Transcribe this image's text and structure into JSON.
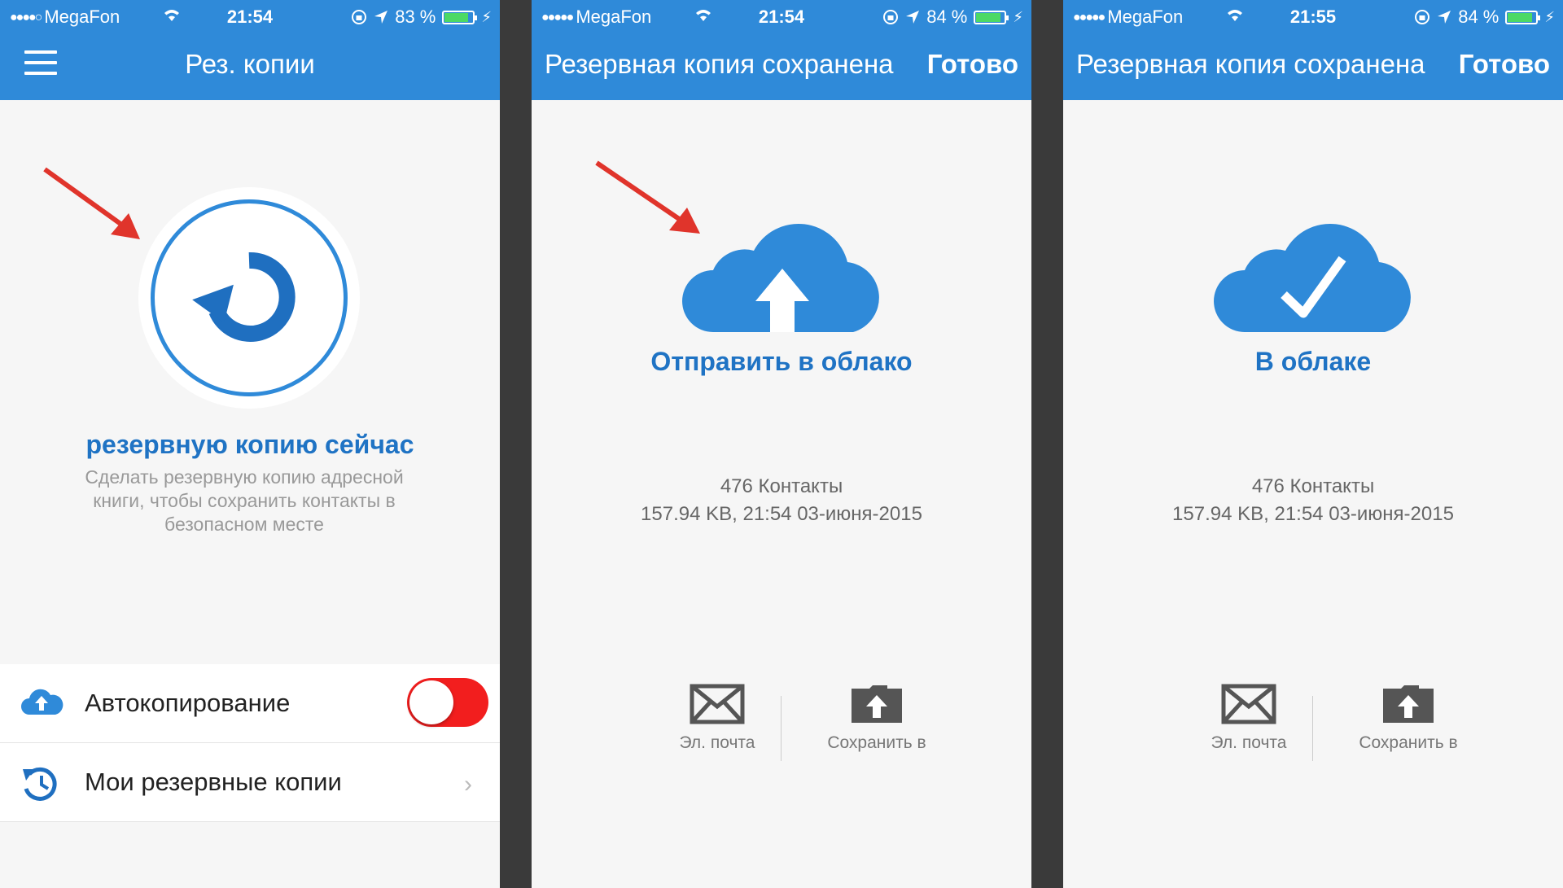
{
  "colors": {
    "accent": "#2f8ad9",
    "title_blue": "#1f73c4",
    "toggle_red": "#f21e1e",
    "arrow_red": "#e0342b"
  },
  "screens": [
    {
      "status": {
        "carrier": "MegaFon",
        "time": "21:54",
        "battery": "83 %"
      },
      "nav": {
        "title": "Рез. копии",
        "menu_icon": "hamburger-icon"
      },
      "backup": {
        "icon": "refresh-icon",
        "title": "резервную копию сейчас",
        "desc_line1": "Сделать резервную копию адресной",
        "desc_line2": "книги, чтобы сохранить контакты в",
        "desc_line3": "безопасном месте"
      },
      "list": [
        {
          "label": "Автокопирование",
          "icon": "cloud-upload-icon",
          "toggle_on": true
        },
        {
          "label": "Мои резервные копии",
          "icon": "history-icon"
        }
      ]
    },
    {
      "status": {
        "carrier": "MegaFon",
        "time": "21:54",
        "battery": "84 %"
      },
      "nav": {
        "title": "Резервная копия сохранена",
        "done": "Готово"
      },
      "cloud": {
        "icon": "cloud-upload-icon",
        "label": "Отправить в облако"
      },
      "info": {
        "contacts": "476 Контакты",
        "details": "157.94 KB, 21:54 03-июня-2015"
      },
      "actions": {
        "email": "Эл. почта",
        "save": "Сохранить в"
      }
    },
    {
      "status": {
        "carrier": "MegaFon",
        "time": "21:55",
        "battery": "84 %"
      },
      "nav": {
        "title": "Резервная копия сохранена",
        "done": "Готово"
      },
      "cloud": {
        "icon": "cloud-check-icon",
        "label": "В облаке"
      },
      "info": {
        "contacts": "476 Контакты",
        "details": "157.94 KB, 21:54 03-июня-2015"
      },
      "actions": {
        "email": "Эл. почта",
        "save": "Сохранить в"
      }
    }
  ]
}
